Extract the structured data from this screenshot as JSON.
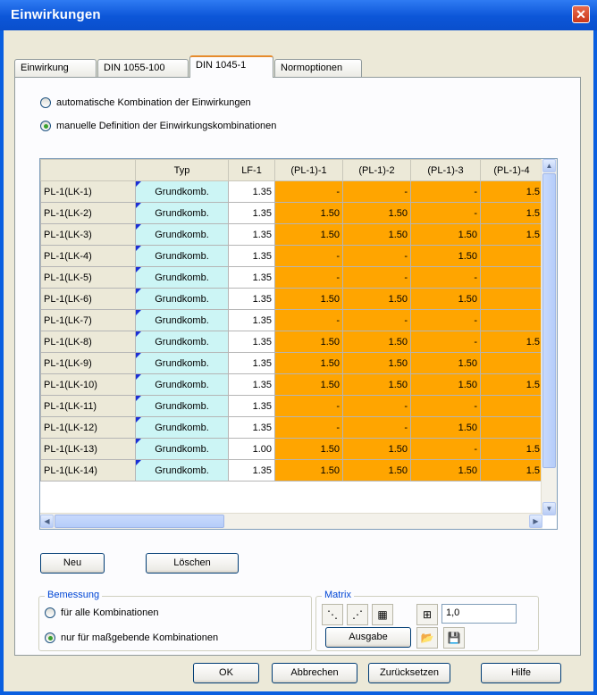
{
  "window": {
    "title": "Einwirkungen",
    "close_icon": "close-icon"
  },
  "tabs": [
    {
      "label": "Einwirkung"
    },
    {
      "label": "DIN 1055-100"
    },
    {
      "label": "DIN 1045-1"
    },
    {
      "label": "Normoptionen"
    }
  ],
  "active_tab": "DIN 1045-1",
  "mode": {
    "auto_label": "automatische Kombination der Einwirkungen",
    "manual_label": "manuelle Definition der Einwirkungskombinationen",
    "selected": "manual"
  },
  "grid": {
    "headers": [
      "",
      "Typ",
      "LF-1",
      "(PL-1)-1",
      "(PL-1)-2",
      "(PL-1)-3",
      "(PL-1)-4"
    ],
    "rows": [
      {
        "name": "PL-1(LK-1)",
        "typ": "Grundkomb.",
        "lf": "1.35",
        "v": [
          "-",
          "-",
          "-",
          "1.5"
        ]
      },
      {
        "name": "PL-1(LK-2)",
        "typ": "Grundkomb.",
        "lf": "1.35",
        "v": [
          "1.50",
          "1.50",
          "-",
          "1.5"
        ]
      },
      {
        "name": "PL-1(LK-3)",
        "typ": "Grundkomb.",
        "lf": "1.35",
        "v": [
          "1.50",
          "1.50",
          "1.50",
          "1.5"
        ]
      },
      {
        "name": "PL-1(LK-4)",
        "typ": "Grundkomb.",
        "lf": "1.35",
        "v": [
          "-",
          "-",
          "1.50",
          ""
        ]
      },
      {
        "name": "PL-1(LK-5)",
        "typ": "Grundkomb.",
        "lf": "1.35",
        "v": [
          "-",
          "-",
          "-",
          ""
        ]
      },
      {
        "name": "PL-1(LK-6)",
        "typ": "Grundkomb.",
        "lf": "1.35",
        "v": [
          "1.50",
          "1.50",
          "1.50",
          ""
        ]
      },
      {
        "name": "PL-1(LK-7)",
        "typ": "Grundkomb.",
        "lf": "1.35",
        "v": [
          "-",
          "-",
          "-",
          ""
        ]
      },
      {
        "name": "PL-1(LK-8)",
        "typ": "Grundkomb.",
        "lf": "1.35",
        "v": [
          "1.50",
          "1.50",
          "-",
          "1.5"
        ]
      },
      {
        "name": "PL-1(LK-9)",
        "typ": "Grundkomb.",
        "lf": "1.35",
        "v": [
          "1.50",
          "1.50",
          "1.50",
          ""
        ]
      },
      {
        "name": "PL-1(LK-10)",
        "typ": "Grundkomb.",
        "lf": "1.35",
        "v": [
          "1.50",
          "1.50",
          "1.50",
          "1.5"
        ]
      },
      {
        "name": "PL-1(LK-11)",
        "typ": "Grundkomb.",
        "lf": "1.35",
        "v": [
          "-",
          "-",
          "-",
          ""
        ]
      },
      {
        "name": "PL-1(LK-12)",
        "typ": "Grundkomb.",
        "lf": "1.35",
        "v": [
          "-",
          "-",
          "1.50",
          ""
        ]
      },
      {
        "name": "PL-1(LK-13)",
        "typ": "Grundkomb.",
        "lf": "1.00",
        "v": [
          "1.50",
          "1.50",
          "-",
          "1.5"
        ]
      },
      {
        "name": "PL-1(LK-14)",
        "typ": "Grundkomb.",
        "lf": "1.35",
        "v": [
          "1.50",
          "1.50",
          "1.50",
          "1.5"
        ]
      }
    ]
  },
  "buttons": {
    "neu": "Neu",
    "loeschen": "Löschen",
    "ausgabe": "Ausgabe",
    "ok": "OK",
    "abbrechen": "Abbrechen",
    "zuruecksetzen": "Zurücksetzen",
    "hilfe": "Hilfe"
  },
  "bemessung": {
    "legend": "Bemessung",
    "all_label": "für alle Kombinationen",
    "relevant_label": "nur für maßgebende Kombinationen",
    "selected": "relevant"
  },
  "matrix": {
    "legend": "Matrix",
    "value": "1,0"
  },
  "colors": {
    "accent": "#ffa500",
    "typ_cell": "#ccf5f5",
    "title_bar": "#0a5fe0"
  }
}
